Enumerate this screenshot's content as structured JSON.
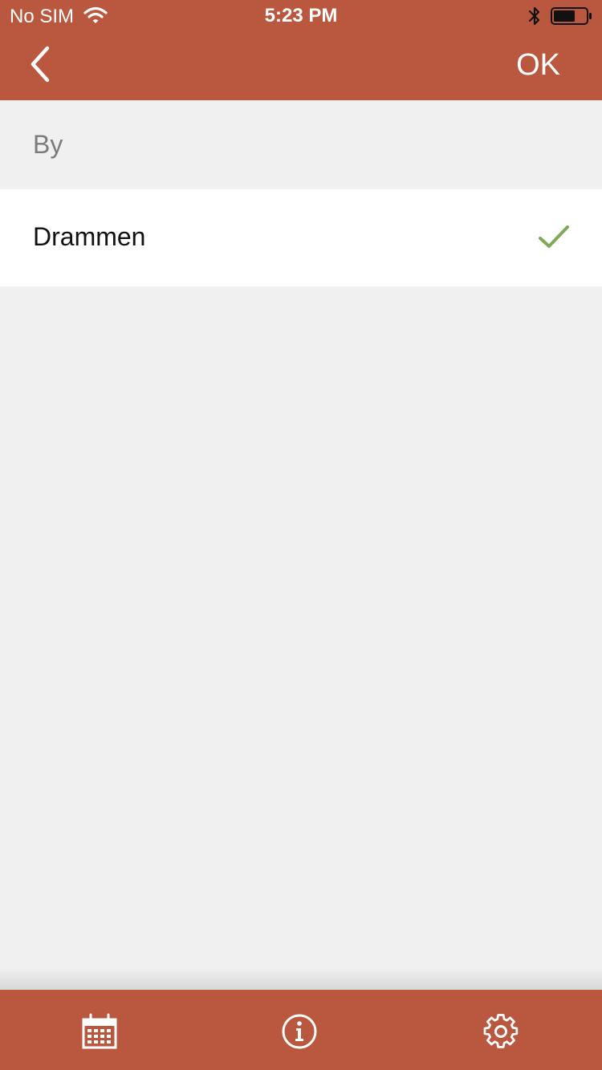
{
  "status_bar": {
    "carrier": "No SIM",
    "time": "5:23 PM",
    "icons": [
      "wifi-icon",
      "bluetooth-icon",
      "battery-icon"
    ]
  },
  "nav": {
    "back_icon": "chevron-left-icon",
    "ok_label": "OK"
  },
  "section": {
    "title": "By"
  },
  "list": {
    "items": [
      {
        "label": "Drammen",
        "selected": true,
        "icon": "checkmark-icon"
      }
    ]
  },
  "tabbar": {
    "tabs": [
      {
        "icon": "calendar-icon"
      },
      {
        "icon": "info-icon"
      },
      {
        "icon": "settings-gear-icon"
      }
    ]
  },
  "colors": {
    "brand": "#b9583e",
    "background": "#f0f0f0",
    "check": "#7fa85a",
    "section_text": "#7b7b7b"
  }
}
